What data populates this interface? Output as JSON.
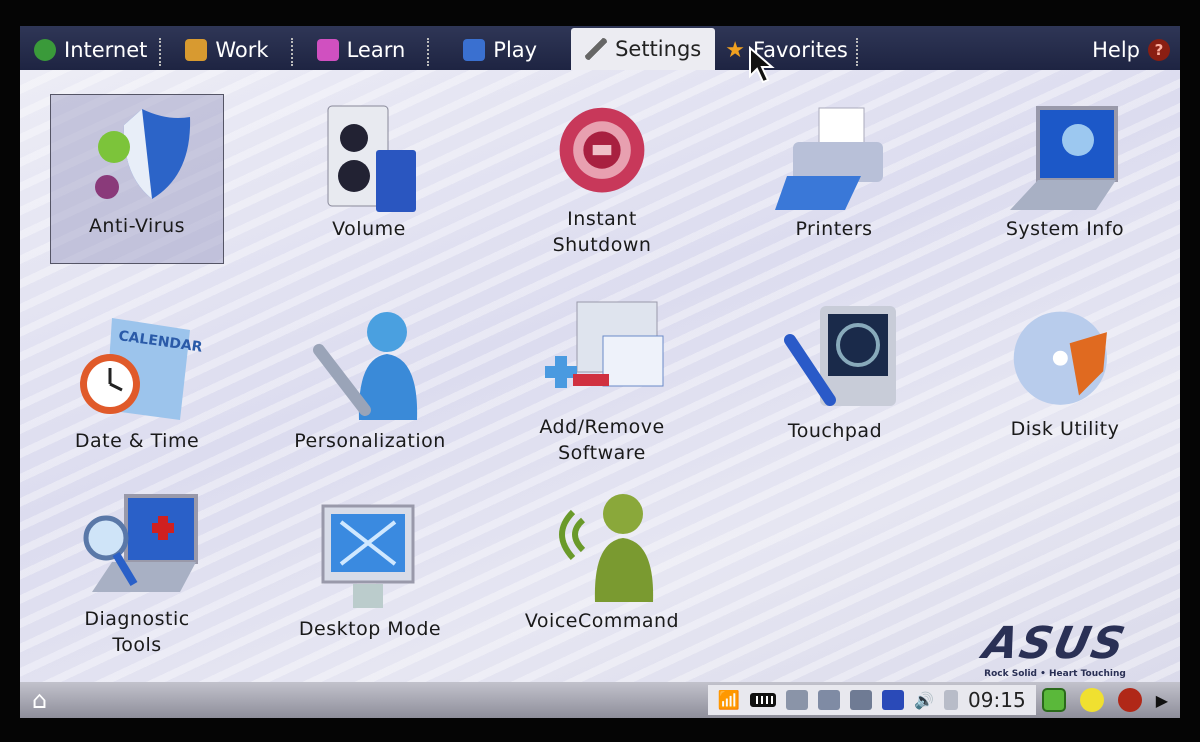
{
  "topbar": {
    "tabs": [
      {
        "label": "Internet",
        "icon": "globe-icon",
        "color": "#3a9a3a"
      },
      {
        "label": "Work",
        "icon": "folder-icon",
        "color": "#d89a30"
      },
      {
        "label": "Learn",
        "icon": "book-icon",
        "color": "#d050c0"
      },
      {
        "label": "Play",
        "icon": "game-icon",
        "color": "#3a70d0"
      },
      {
        "label": "Settings",
        "icon": "wrench-icon",
        "color": "#777",
        "active": true
      },
      {
        "label": "Favorites",
        "icon": "star-icon",
        "color": "#f0a020"
      }
    ],
    "help": "Help",
    "help_icon": "?"
  },
  "items": [
    {
      "label": "Anti-Virus",
      "icon": "shield-bug-icon",
      "selected": true
    },
    {
      "label": "Volume",
      "icon": "speaker-icon"
    },
    {
      "label": "Instant\nShutdown",
      "icon": "power-button-icon"
    },
    {
      "label": "Printers",
      "icon": "printer-icon"
    },
    {
      "label": "System Info",
      "icon": "laptop-info-icon"
    },
    {
      "label": "Date & Time",
      "icon": "calendar-clock-icon",
      "calendar": "CALENDAR"
    },
    {
      "label": "Personalization",
      "icon": "person-wrench-icon"
    },
    {
      "label": "Add/Remove\nSoftware",
      "icon": "add-remove-icon"
    },
    {
      "label": "Touchpad",
      "icon": "touchpad-icon"
    },
    {
      "label": "Disk Utility",
      "icon": "disk-icon"
    },
    {
      "label": "Diagnostic\nTools",
      "icon": "diagnostic-icon"
    },
    {
      "label": "Desktop Mode",
      "icon": "monitor-icon"
    },
    {
      "label": "VoiceCommand",
      "icon": "voice-person-icon"
    }
  ],
  "brand": {
    "logo": "ASUS",
    "tagline": "Rock Solid • Heart Touching"
  },
  "bottombar": {
    "clock": "09:15",
    "tray": [
      "wifi-icon",
      "battery-icon",
      "network-icon",
      "input-method-icon",
      "keyboard-icon",
      "eraser-icon",
      "volume-icon",
      "storage-icon"
    ],
    "extras": [
      "desktop-grid-icon",
      "smiley-icon",
      "power-icon",
      "arrow-right-icon"
    ]
  }
}
